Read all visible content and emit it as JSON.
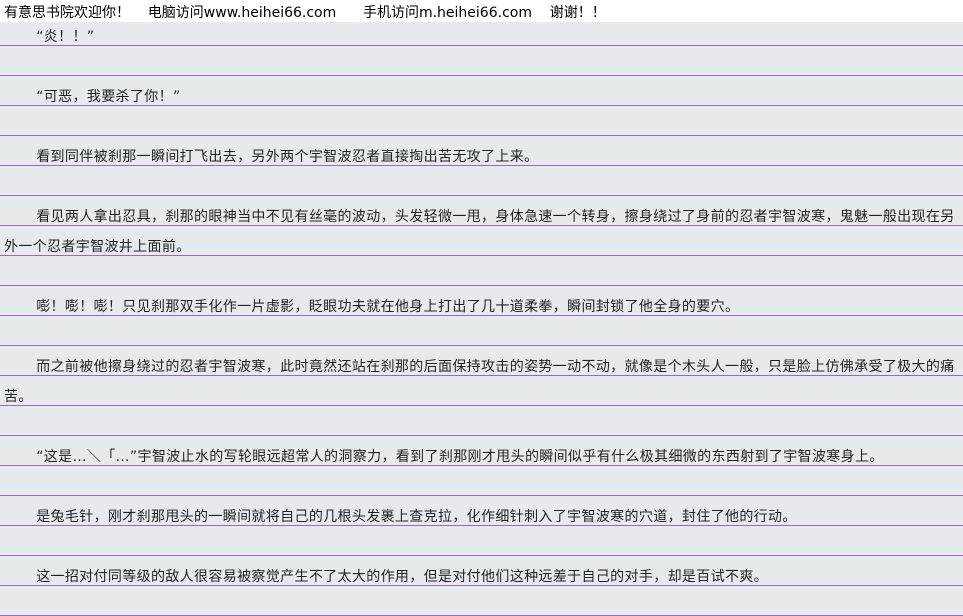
{
  "header": {
    "welcome": "有意思书院欢迎你！",
    "pc_access": "电脑访问www.heihei66.com",
    "mobile_access": "手机访问m.heihei66.com",
    "thanks": "谢谢！！"
  },
  "paragraphs": [
    "“炎！！”",
    "“可恶，我要杀了你！”",
    "看到同伴被刹那一瞬间打飞出去，另外两个宇智波忍者直接掏出苦无攻了上来。",
    "看见两人拿出忍具，刹那的眼神当中不见有丝毫的波动，头发轻微一甩，身体急速一个转身，擦身绕过了身前的忍者宇智波寒，鬼魅一般出现在另外一个忍者宇智波井上面前。",
    "嘭！嘭！嘭！只见刹那双手化作一片虚影，眨眼功夫就在他身上打出了几十道柔拳，瞬间封锁了他全身的要穴。",
    "而之前被他擦身绕过的忍者宇智波寒，此时竟然还站在刹那的后面保持攻击的姿势一动不动，就像是个木头人一般，只是脸上仿佛承受了极大的痛苦。",
    "“这是…＼「…”宇智波止水的写轮眼远超常人的洞察力，看到了刹那刚才甩头的瞬间似乎有什么极其细微的东西射到了宇智波寒身上。",
    "是兔毛针，刚才刹那甩头的一瞬间就将自己的几根头发裹上查克拉，化作细针刺入了宇智波寒的穴道，封住了他的行动。",
    "这一招对付同等级的敌人很容易被察觉产生不了太大的作用，但是对付他们这种远差于自己的对手，却是百试不爽。"
  ]
}
